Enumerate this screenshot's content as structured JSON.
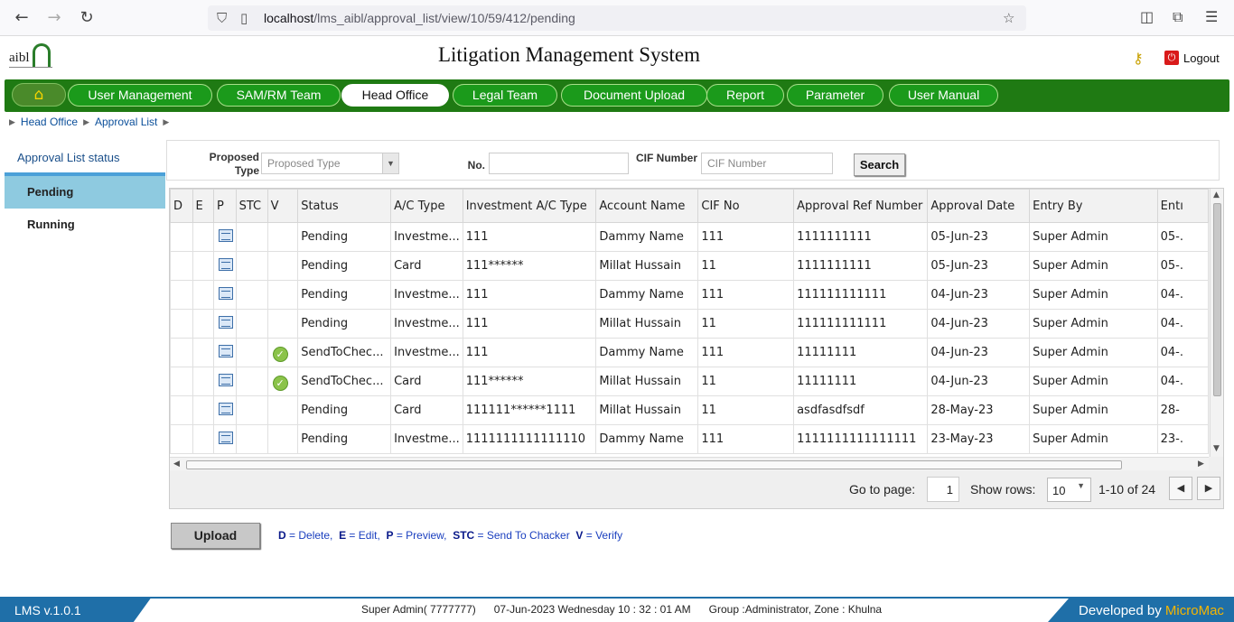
{
  "browser": {
    "url_host": "localhost",
    "url_path": "/lms_aibl/approval_list/view/10/59/412/pending"
  },
  "header": {
    "logo_text": "aibl",
    "title": "Litigation Management System",
    "logout_label": "Logout"
  },
  "nav": {
    "items": [
      {
        "label": "User Management"
      },
      {
        "label": "SAM/RM Team"
      },
      {
        "label": "Head Office"
      },
      {
        "label": "Legal Team"
      },
      {
        "label": "Document Upload"
      },
      {
        "label": "Report"
      },
      {
        "label": "Parameter"
      },
      {
        "label": "User Manual"
      }
    ],
    "active": "Head Office"
  },
  "breadcrumb": [
    "Head Office",
    "Approval List"
  ],
  "sidebar": {
    "title": "Approval List status",
    "items": [
      {
        "label": "Pending"
      },
      {
        "label": "Running"
      }
    ]
  },
  "filters": {
    "proposed_type_label": "Proposed Type",
    "proposed_type_placeholder": "Proposed Type",
    "no_label": "No.",
    "no_value": "",
    "cif_label": "CIF Number",
    "cif_placeholder": "CIF Number",
    "search_label": "Search"
  },
  "table": {
    "columns": [
      "D",
      "E",
      "P",
      "STC",
      "V",
      "Status",
      "A/C Type",
      "Investment A/C Type",
      "Account Name",
      "CIF No",
      "Approval Ref Number",
      "Approval Date",
      "Entry By",
      "Entı"
    ],
    "rows": [
      {
        "verified": false,
        "status": "Pending",
        "ac_type": "Investme...",
        "inv_type": "111",
        "name": "Dammy Name",
        "cif": "111",
        "ref": "1111111111",
        "date": "05-Jun-23",
        "entry_by": "Super Admin",
        "entry": "05-."
      },
      {
        "verified": false,
        "status": "Pending",
        "ac_type": "Card",
        "inv_type": "111******",
        "name": "Millat Hussain",
        "cif": "11",
        "ref": "1111111111",
        "date": "05-Jun-23",
        "entry_by": "Super Admin",
        "entry": "05-."
      },
      {
        "verified": false,
        "status": "Pending",
        "ac_type": "Investme...",
        "inv_type": "111",
        "name": "Dammy Name",
        "cif": "111",
        "ref": "111111111111",
        "date": "04-Jun-23",
        "entry_by": "Super Admin",
        "entry": "04-."
      },
      {
        "verified": false,
        "status": "Pending",
        "ac_type": "Investme...",
        "inv_type": "111",
        "name": "Millat Hussain",
        "cif": "11",
        "ref": "111111111111",
        "date": "04-Jun-23",
        "entry_by": "Super Admin",
        "entry": "04-."
      },
      {
        "verified": true,
        "status": "SendToChec...",
        "ac_type": "Investme...",
        "inv_type": "111",
        "name": "Dammy Name",
        "cif": "111",
        "ref": "11111111",
        "date": "04-Jun-23",
        "entry_by": "Super Admin",
        "entry": "04-."
      },
      {
        "verified": true,
        "status": "SendToChec...",
        "ac_type": "Card",
        "inv_type": "111******",
        "name": "Millat Hussain",
        "cif": "11",
        "ref": "11111111",
        "date": "04-Jun-23",
        "entry_by": "Super Admin",
        "entry": "04-."
      },
      {
        "verified": false,
        "status": "Pending",
        "ac_type": "Card",
        "inv_type": "111111******1111",
        "name": "Millat Hussain",
        "cif": "11",
        "ref": "asdfasdfsdf",
        "date": "28-May-23",
        "entry_by": "Super Admin",
        "entry": "28-"
      },
      {
        "verified": false,
        "status": "Pending",
        "ac_type": "Investme...",
        "inv_type": "1111111111111110",
        "name": "Dammy Name",
        "cif": "111",
        "ref": "1111111111111111",
        "date": "23-May-23",
        "entry_by": "Super Admin",
        "entry": "23-."
      }
    ]
  },
  "pager": {
    "goto_label": "Go to page:",
    "page": "1",
    "rows_label": "Show rows:",
    "rows": "10",
    "range": "1-10 of 24"
  },
  "upload_label": "Upload",
  "legend": {
    "d_key": "D",
    "d_text": "= Delete,",
    "e_key": "E",
    "e_text": "= Edit,",
    "p_key": "P",
    "p_text": "= Preview,",
    "stc_key": "STC",
    "stc_text": "= Send To Chacker",
    "v_key": "V",
    "v_text": "= Verify"
  },
  "footer": {
    "version": "LMS v.1.0.1",
    "user": "Super Admin( 7777777)",
    "datetime": "07-Jun-2023 Wednesday 10 : 32 : 01 AM",
    "group": "Group :Administrator, Zone : Khulna",
    "developed_by": "Developed by",
    "brand": "MicroMac"
  },
  "colors": {
    "nav_green": "#1f7a13",
    "active_sidebar": "#8ecae0",
    "footer_blue": "#1f6fa8",
    "brand_orange": "#f6b500"
  }
}
